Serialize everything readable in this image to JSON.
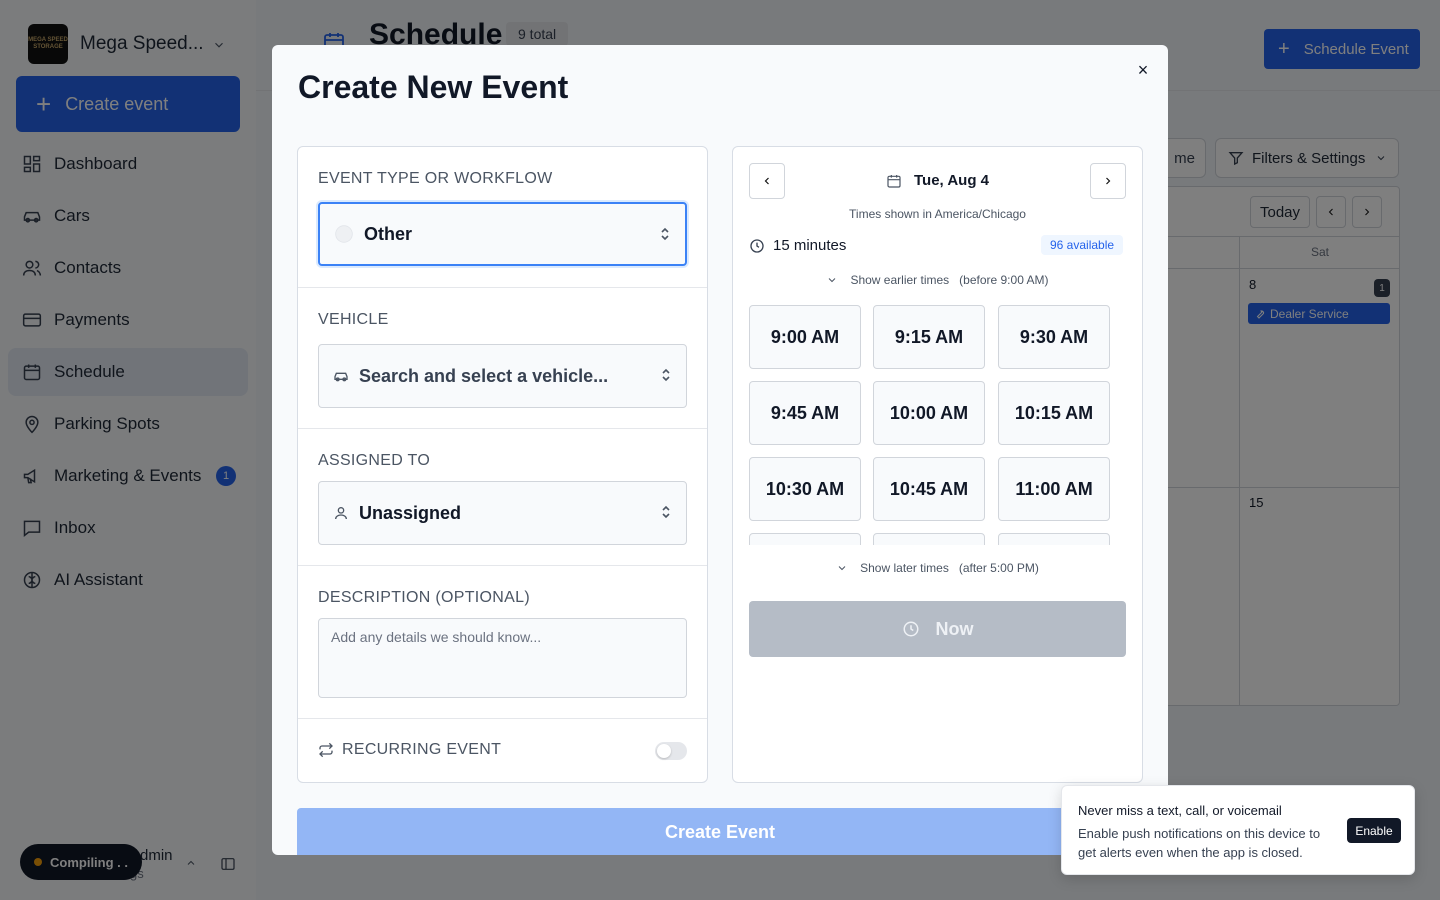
{
  "sidebar": {
    "org_name": "Mega Speed...",
    "org_logo_text": "MEGA SPEED STORAGE",
    "create_label": "Create event",
    "items": [
      {
        "label": "Dashboard",
        "icon": "dashboard-icon"
      },
      {
        "label": "Cars",
        "icon": "car-icon"
      },
      {
        "label": "Contacts",
        "icon": "users-icon"
      },
      {
        "label": "Payments",
        "icon": "credit-card-icon"
      },
      {
        "label": "Schedule",
        "icon": "calendar-icon",
        "active": true
      },
      {
        "label": "Parking Spots",
        "icon": "map-pin-icon"
      },
      {
        "label": "Marketing & Events",
        "icon": "megaphone-icon",
        "badge": "1"
      },
      {
        "label": "Inbox",
        "icon": "message-square-icon"
      },
      {
        "label": "AI Assistant",
        "icon": "brain-icon"
      }
    ],
    "compiling_label": "Compiling . .",
    "user_name": "Admin",
    "user_sub": "gs"
  },
  "page": {
    "title": "Schedule",
    "count_badge": "9 total",
    "schedule_button": "Schedule Event",
    "me_button": "me",
    "filters_button": "Filters & Settings",
    "calendar": {
      "today_button": "Today",
      "day_header": "Sat",
      "day_numbers": [
        "8",
        "15"
      ],
      "day_event_count": "1",
      "event_chip": "Dealer Service"
    }
  },
  "modal": {
    "title": "Create New Event",
    "close_glyph": "×",
    "event_type": {
      "label": "EVENT TYPE OR WORKFLOW",
      "value": "Other"
    },
    "vehicle": {
      "label": "VEHICLE",
      "placeholder": "Search and select a vehicle..."
    },
    "assigned": {
      "label": "ASSIGNED TO",
      "value": "Unassigned"
    },
    "description": {
      "label": "DESCRIPTION (OPTIONAL)",
      "placeholder": "Add any details we should know..."
    },
    "recurring": {
      "label": "RECURRING EVENT",
      "enabled": false
    },
    "picker": {
      "date": "Tue, Aug 4",
      "timezone_note": "Times shown in America/Chicago",
      "duration": "15 minutes",
      "available": "96 available",
      "show_earlier": "Show earlier times",
      "earlier_note": "(before 9:00 AM)",
      "show_later": "Show later times",
      "later_note": "(after 5:00 PM)",
      "slots": [
        "9:00 AM",
        "9:15 AM",
        "9:30 AM",
        "9:45 AM",
        "10:00 AM",
        "10:15 AM",
        "10:30 AM",
        "10:45 AM",
        "11:00 AM",
        "",
        "",
        ""
      ],
      "now_button": "Now"
    },
    "submit_label": "Create Event"
  },
  "toast": {
    "title": "Never miss a text, call, or voicemail",
    "body": "Enable push notifications on this device to get alerts even when the app is closed.",
    "button": "Enable"
  },
  "colors": {
    "accent": "#2563eb",
    "overlay": "rgba(0,0,0,0.5)",
    "disabled_submit": "#93b6f5"
  }
}
